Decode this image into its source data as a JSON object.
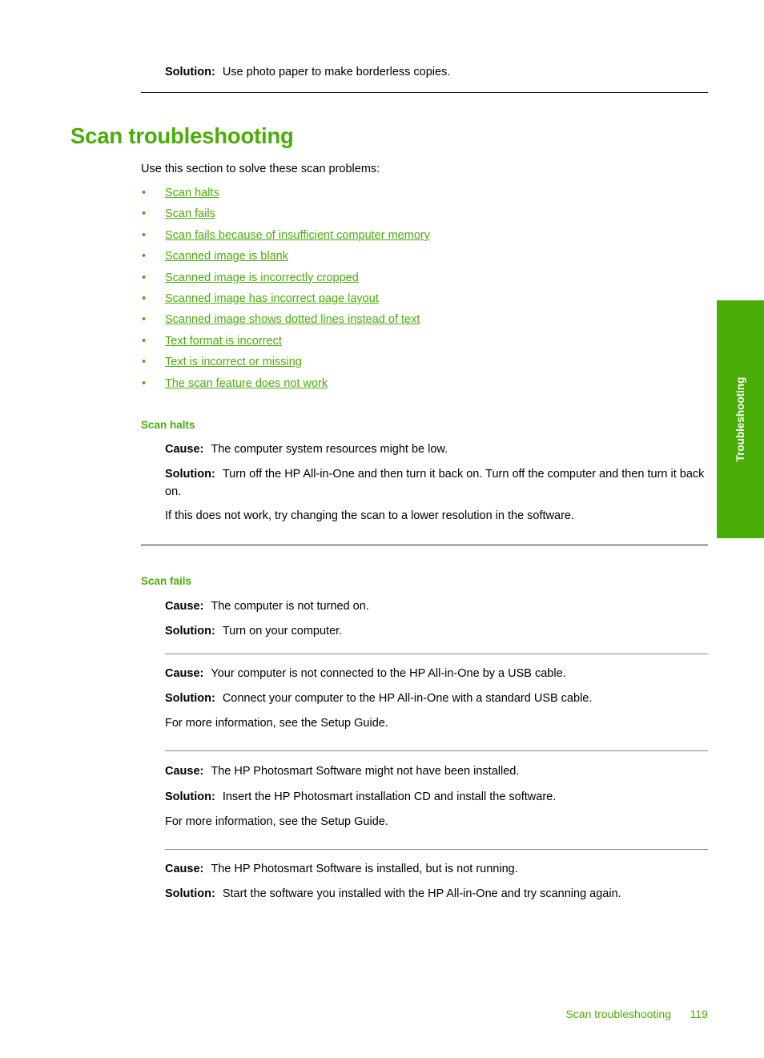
{
  "page": {
    "number": "119",
    "footer_section": "Scan troubleshooting",
    "side_tab_label": "Troubleshooting"
  },
  "top_block": {
    "solution_label": "Solution:",
    "solution_text": "Use photo paper to make borderless copies."
  },
  "title": "Scan troubleshooting",
  "intro": "Use this section to solve these scan problems:",
  "toc_links": [
    {
      "bullet": "•",
      "label": "Scan halts"
    },
    {
      "bullet": "•",
      "label": "Scan fails"
    },
    {
      "bullet": "•",
      "label": "Scan fails because of insufficient computer memory"
    },
    {
      "bullet": "•",
      "label": "Scanned image is blank"
    },
    {
      "bullet": "•",
      "label": "Scanned image is incorrectly cropped"
    },
    {
      "bullet": "•",
      "label": "Scanned image has incorrect page layout"
    },
    {
      "bullet": "•",
      "label": "Scanned image shows dotted lines instead of text"
    },
    {
      "bullet": "•",
      "label": "Text format is incorrect"
    },
    {
      "bullet": "•",
      "label": "Text is incorrect or missing"
    },
    {
      "bullet": "•",
      "label": "The scan feature does not work"
    }
  ],
  "labels": {
    "cause": "Cause:",
    "solution": "Solution:"
  },
  "sections": [
    {
      "heading": "Scan halts",
      "blocks": [
        {
          "cause": "The computer system resources might be low.",
          "solution": "Turn off the HP All-in-One and then turn it back on. Turn off the computer and then turn it back on.",
          "note": "If this does not work, try changing the scan to a lower resolution in the software."
        }
      ]
    },
    {
      "heading": "Scan fails",
      "blocks": [
        {
          "cause": "The computer is not turned on.",
          "solution": "Turn on your computer.",
          "note": ""
        },
        {
          "cause": "Your computer is not connected to the HP All-in-One by a USB cable.",
          "solution": "Connect your computer to the HP All-in-One with a standard USB cable.",
          "note": "For more information, see the Setup Guide."
        },
        {
          "cause": "The HP Photosmart Software might not have been installed.",
          "solution": "Insert the HP Photosmart installation CD and install the software.",
          "note": "For more information, see the Setup Guide."
        },
        {
          "cause": "The HP Photosmart Software is installed, but is not running.",
          "solution": "Start the software you installed with the HP All-in-One and try scanning again.",
          "note": ""
        }
      ]
    }
  ],
  "colors": {
    "green": "#4aad07",
    "rule_dark": "#1a1a1a",
    "rule_light": "#878787"
  }
}
